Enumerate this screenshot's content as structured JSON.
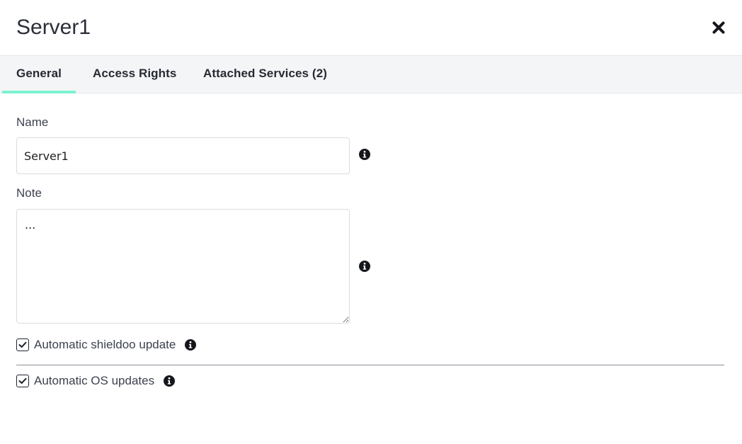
{
  "header": {
    "title": "Server1",
    "close_icon": "close-icon"
  },
  "tabs": [
    {
      "label": "General",
      "active": true
    },
    {
      "label": "Access Rights",
      "active": false
    },
    {
      "label": "Attached Services (2)",
      "active": false
    }
  ],
  "form": {
    "name": {
      "label": "Name",
      "value": "Server1",
      "info_icon": "info-icon"
    },
    "note": {
      "label": "Note",
      "value": "...",
      "info_icon": "info-icon"
    },
    "auto_shieldoo_update": {
      "label": "Automatic shieldoo update",
      "checked": true,
      "info_icon": "info-icon"
    },
    "auto_os_updates": {
      "label": "Automatic OS updates",
      "checked": true,
      "info_icon": "info-icon"
    }
  },
  "colors": {
    "tab_active_underline": "#7cf2d0",
    "tabbar_background": "#f4f5f7",
    "text": "#1f2430"
  }
}
